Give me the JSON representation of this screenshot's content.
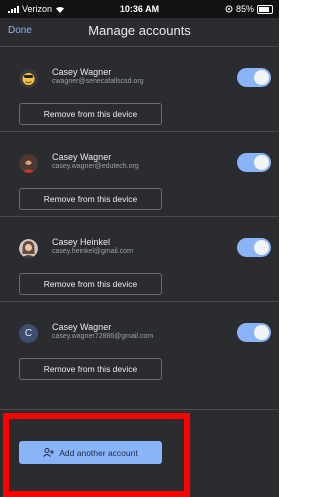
{
  "status_bar": {
    "carrier": "Verizon",
    "time": "10:36 AM",
    "battery": "85%"
  },
  "header": {
    "done_label": "Done",
    "title": "Manage accounts"
  },
  "accounts": [
    {
      "name": "Casey Wagner",
      "email": "cwagner@senecafallscsd.org",
      "avatar_icon": "emoji-avatar-icon",
      "remove_label": "Remove from this device"
    },
    {
      "name": "Casey Wagner",
      "email": "casey.wagner@edutech.org",
      "avatar_icon": "photo-avatar-icon",
      "remove_label": "Remove from this device"
    },
    {
      "name": "Casey Heinkel",
      "email": "casey.heinkel@gmail.com",
      "avatar_icon": "photo-avatar-icon",
      "remove_label": "Remove from this device"
    },
    {
      "name": "Casey Wagner",
      "email": "casey.wagner72886@gmail.com",
      "avatar_letter": "C",
      "remove_label": "Remove from this device"
    }
  ],
  "add_account_label": "Add another account",
  "colors": {
    "background": "#2b2c2f",
    "accent": "#8ab4f8",
    "highlight": "#ff0000"
  }
}
